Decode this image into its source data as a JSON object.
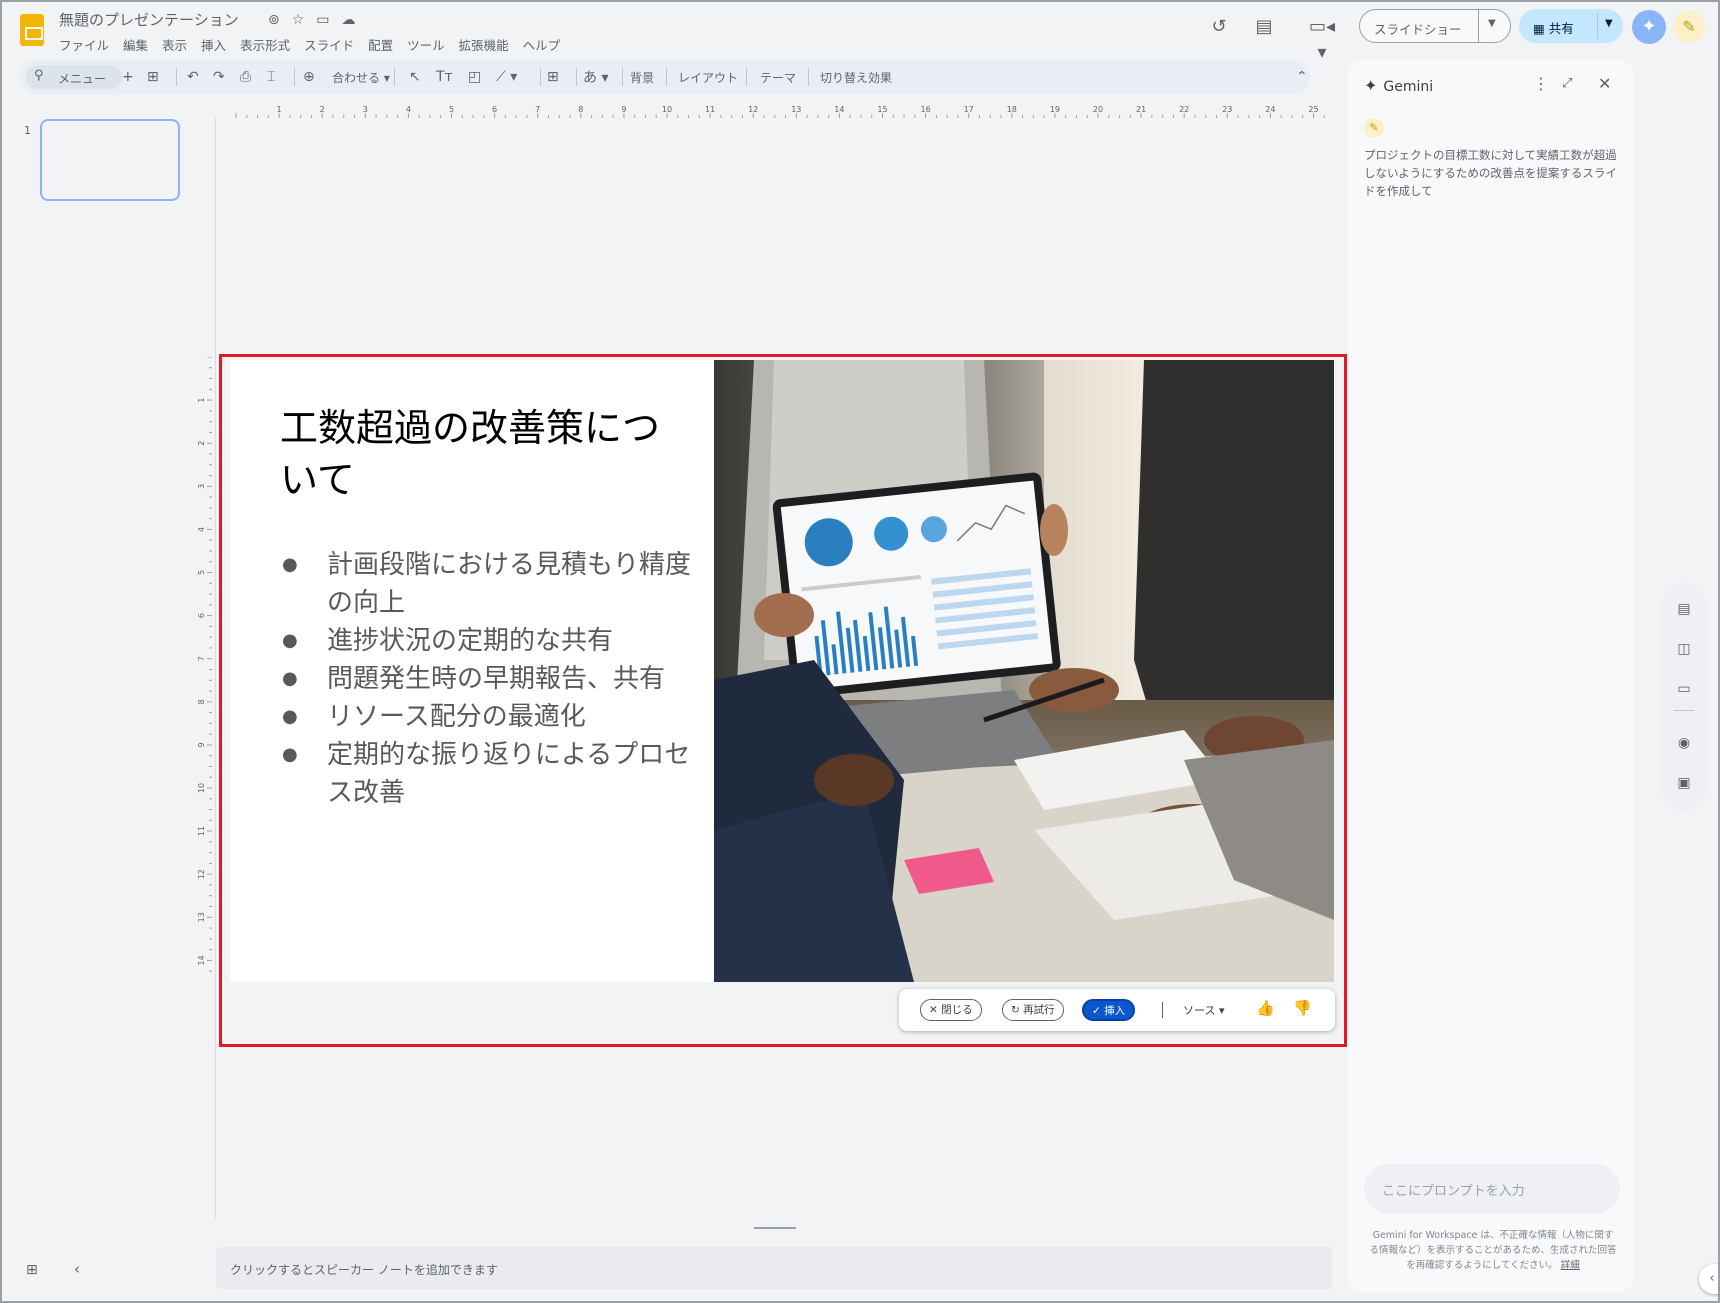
{
  "header": {
    "doc_title": "無題のプレゼンテーション",
    "menu": [
      "ファイル",
      "編集",
      "表示",
      "挿入",
      "表示形式",
      "スライド",
      "配置",
      "ツール",
      "拡張機能",
      "ヘルプ"
    ],
    "slideshow_label": "スライドショー",
    "share_label": "共有"
  },
  "toolbar": {
    "search_label": "メニュー",
    "zoom_label": "合わせる",
    "font_label": "あ",
    "background_label": "背景",
    "layout_label": "レイアウト",
    "theme_label": "テーマ",
    "transition_label": "切り替え効果"
  },
  "ruler": {
    "horizontal": [
      "1",
      "2",
      "3",
      "4",
      "5",
      "6",
      "7",
      "8",
      "9",
      "10",
      "11",
      "12",
      "13",
      "14",
      "15",
      "16",
      "17",
      "18",
      "19",
      "20",
      "21",
      "22",
      "23",
      "24",
      "25"
    ],
    "vertical": [
      "1",
      "2",
      "3",
      "4",
      "5",
      "6",
      "7",
      "8",
      "9",
      "10",
      "11",
      "12",
      "13",
      "14"
    ]
  },
  "filmstrip": {
    "slide_number": "1"
  },
  "slide": {
    "title": "工数超過の改善策について",
    "bullets": [
      "計画段階における見積もり精度の向上",
      "進捗状況の定期的な共有",
      "問題発生時の早期報告、共有",
      "リソース配分の最適化",
      "定期的な振り返りによるプロセス改善"
    ]
  },
  "actionbar": {
    "close_label": "閉じる",
    "retry_label": "再試行",
    "insert_label": "挿入",
    "source_label": "ソース"
  },
  "notes": {
    "placeholder": "クリックするとスピーカー ノートを追加できます"
  },
  "gemini": {
    "title": "Gemini",
    "prompt": "プロジェクトの目標工数に対して実績工数が超過しないようにするための改善点を提案するスライドを作成して",
    "input_placeholder": "ここにプロンプトを入力",
    "disclaimer": "Gemini for Workspace は、不正確な情報（人物に関する情報など）を表示することがあるため、生成された回答を再確認するようにしてください。",
    "disclaimer_link": "詳細"
  },
  "icons": {
    "star": "star-icon",
    "move": "folder-move-icon",
    "cloud": "cloud-status-icon",
    "history": "history-icon",
    "comment": "comment-icon",
    "meet": "video-icon"
  },
  "colors": {
    "accent": "#0b57d0",
    "selection": "#e01b24",
    "share_bg": "#c2e7ff"
  }
}
